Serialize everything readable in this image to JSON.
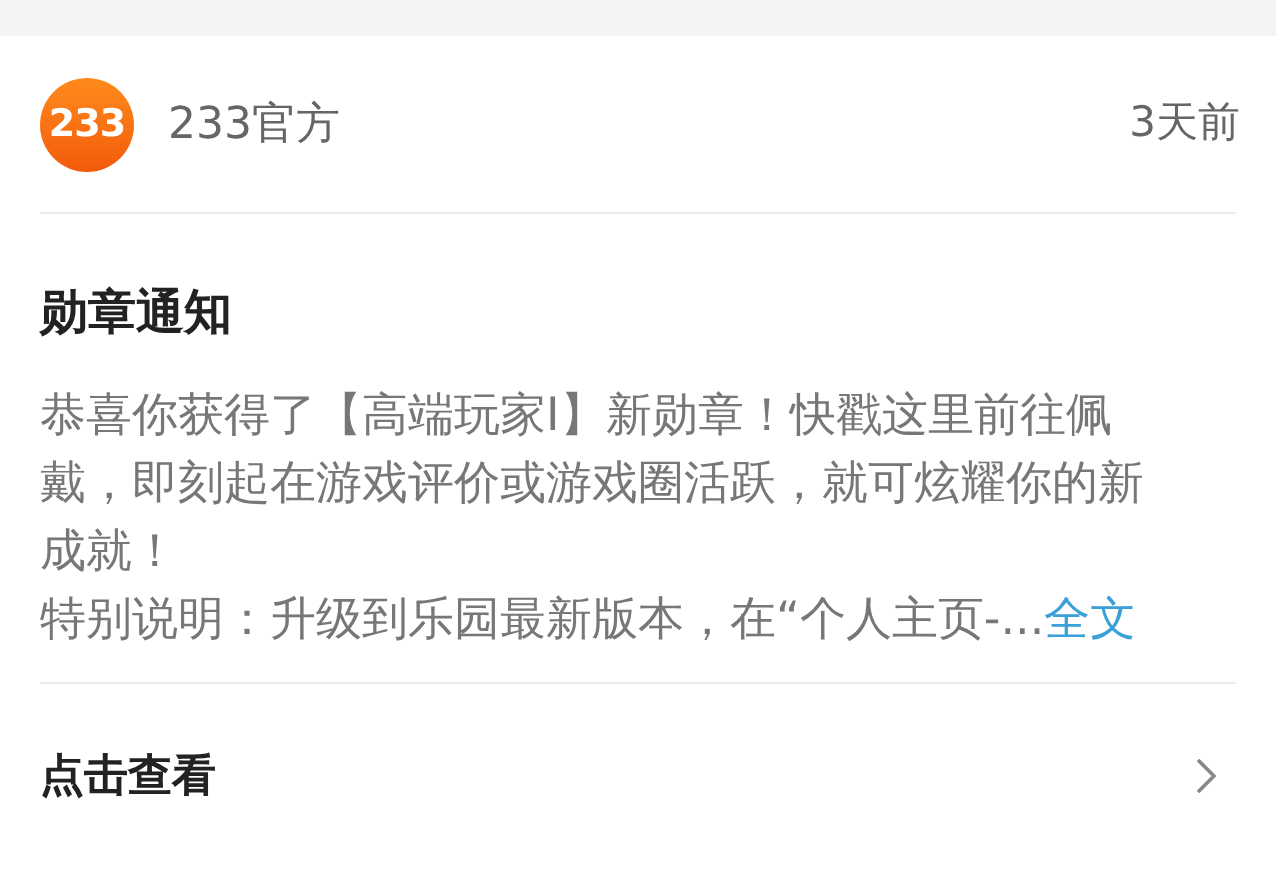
{
  "sender": {
    "name": "233官方",
    "logo_text": "233",
    "time": "3天前"
  },
  "notification": {
    "title": "勋章通知",
    "body": "恭喜你获得了【高端玩家I】新勋章！快戳这里前往佩戴，即刻起在游戏评价或游戏圈活跃，就可炫耀你的新成就！",
    "note": "特别说明：升级到乐园最新版本，在“个人主页-...",
    "more_link": "全文"
  },
  "action": {
    "label": "点击查看"
  }
}
